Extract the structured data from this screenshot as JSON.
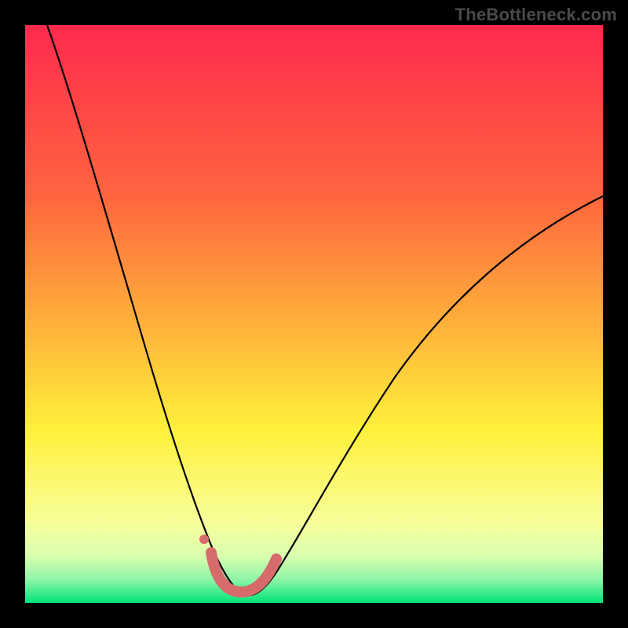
{
  "watermark": "TheBottleneck.com",
  "chart_data": {
    "type": "line",
    "title": "",
    "xlabel": "",
    "ylabel": "",
    "xlim": [
      0,
      100
    ],
    "ylim": [
      0,
      100
    ],
    "background_gradient": {
      "top": "#ff2a4e",
      "mid_upper": "#ffb23a",
      "mid": "#fff03a",
      "mid_lower": "#f8ff9a",
      "bottom": "#00e47a"
    },
    "series": [
      {
        "name": "bottleneck-curve",
        "color": "#000000",
        "x": [
          5,
          10,
          14,
          18,
          22,
          26,
          30,
          32,
          34,
          36,
          38,
          40,
          42,
          44,
          48,
          54,
          62,
          72,
          84,
          100
        ],
        "y": [
          100,
          84,
          70,
          56,
          42,
          28,
          16,
          11,
          7,
          4,
          3,
          4,
          7,
          11,
          20,
          30,
          40,
          50,
          58,
          64
        ]
      }
    ],
    "annotations": [
      {
        "name": "optimal-marker",
        "shape": "rounded-u",
        "color": "#d76b6b",
        "x_range": [
          31,
          43
        ],
        "y": 3
      },
      {
        "name": "optimal-dot",
        "shape": "dot",
        "color": "#d76b6b",
        "x": 30.2,
        "y": 10
      }
    ]
  }
}
